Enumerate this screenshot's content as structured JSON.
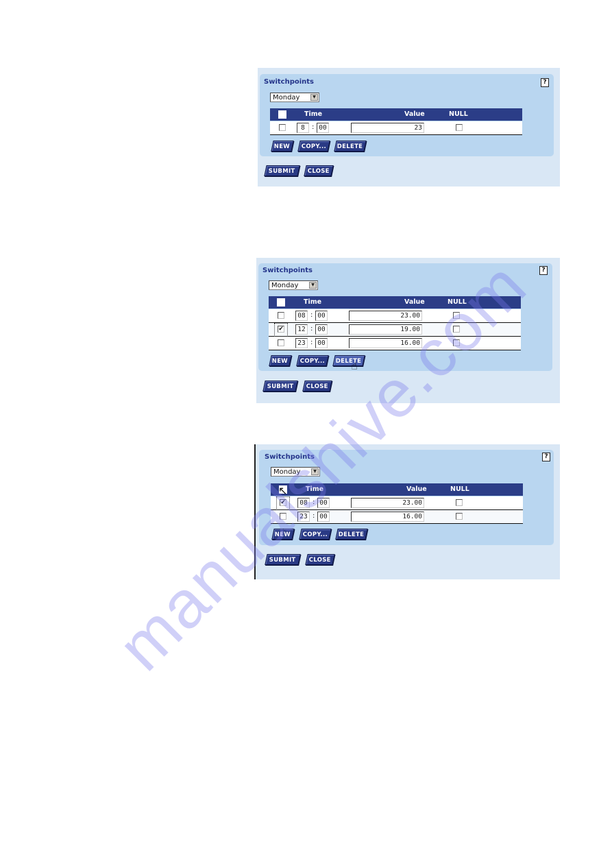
{
  "watermark": "manualshive.com",
  "panels": [
    {
      "title": "Switchpoints",
      "help_label": "?",
      "day_select": "Monday",
      "columns": {
        "time": "Time",
        "value": "Value",
        "null": "NULL"
      },
      "rows": [
        {
          "hour": "8",
          "minute": "00",
          "value": "23",
          "selected": false,
          "null": false
        }
      ],
      "buttons": {
        "new": "NEW",
        "copy": "COPY...",
        "delete": "DELETE",
        "submit": "SUBMIT",
        "close": "CLOSE"
      }
    },
    {
      "title": "Switchpoints",
      "help_label": "?",
      "day_select": "Monday",
      "columns": {
        "time": "Time",
        "value": "Value",
        "null": "NULL"
      },
      "rows": [
        {
          "hour": "08",
          "minute": "00",
          "value": "23.00",
          "selected": false,
          "null": false
        },
        {
          "hour": "12",
          "minute": "00",
          "value": "19.00",
          "selected": true,
          "null": false
        },
        {
          "hour": "23",
          "minute": "00",
          "value": "16.00",
          "selected": false,
          "null": false
        }
      ],
      "buttons": {
        "new": "NEW",
        "copy": "COPY...",
        "delete": "DELETE",
        "submit": "SUBMIT",
        "close": "CLOSE"
      },
      "hovered_button": "delete"
    },
    {
      "title": "Switchpoints",
      "help_label": "?",
      "day_select": "Monday",
      "columns": {
        "time": "Time",
        "value": "Value",
        "null": "NULL"
      },
      "rows": [
        {
          "hour": "08",
          "minute": "00",
          "value": "23.00",
          "selected": true,
          "null": false
        },
        {
          "hour": "23",
          "minute": "00",
          "value": "16.00",
          "selected": false,
          "null": false
        }
      ],
      "buttons": {
        "new": "NEW",
        "copy": "COPY...",
        "delete": "DELETE",
        "submit": "SUBMIT",
        "close": "CLOSE"
      }
    }
  ],
  "icons": {
    "check": "✔",
    "dropdown_arrow": "▼",
    "hand_cursor": "☝",
    "arrow_cursor": "↖"
  }
}
